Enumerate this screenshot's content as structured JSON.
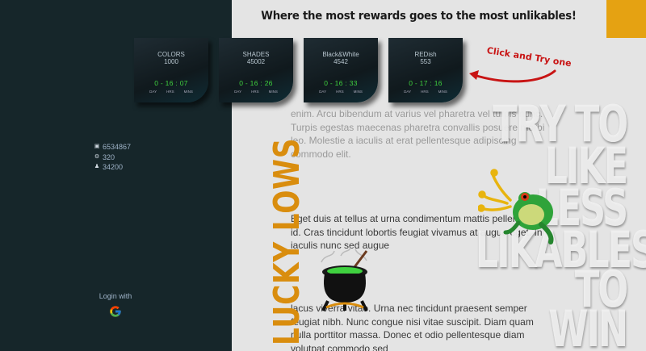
{
  "header": {
    "headline": "Where the most rewards goes to the most unlikables!"
  },
  "cards": [
    {
      "name": "COLORS",
      "count": "1000",
      "timer": "0 - 16 : 07"
    },
    {
      "name": "SHADES",
      "count": "45002",
      "timer": "0 - 16 : 26"
    },
    {
      "name": "Black&White",
      "count": "4542",
      "timer": "0 - 16 : 33"
    },
    {
      "name": "REDish",
      "count": "553",
      "timer": "0 - 17 : 16"
    }
  ],
  "timer_units": {
    "day": "DAY",
    "hrs": "HRS",
    "mins": "MINS"
  },
  "annotation": {
    "text": "Click and Try one"
  },
  "stats": [
    {
      "icon": "trash-icon",
      "value": "6534867"
    },
    {
      "icon": "gear-icon",
      "value": "320"
    },
    {
      "icon": "users-icon",
      "value": "34200"
    }
  ],
  "login": {
    "label": "Login with",
    "provider_icon": "google-icon"
  },
  "side_title": "LUCKY LOWS",
  "overlay_text": [
    "TRY TO",
    "LIKE",
    "LESS",
    "LIKABLES",
    "TO",
    "WIN"
  ],
  "paragraphs": [
    "enim. Arcu bibendum at varius vel pharetra vel turpis nunc. Turpis egestas maecenas pharetra convallis posuere morbi leo. Molestie a iaculis at erat pellentesque adipiscing commodo elit.",
    "Eget duis at tellus at urna condimentum mattis pellentesque id. Cras tincidunt lobortis feugiat vivamus at augue eget. In iaculis nunc sed augue",
    "lacus viverra vitae. Urna nec tincidunt praesent semper feugiat nibh. Nunc congue nisi vitae suscipit. Diam quam nulla porttitor massa. Donec et odio pellentesque diam volutpat commodo sed"
  ],
  "colors": {
    "sidebar": "#16262a",
    "accent": "#e5a212",
    "timer": "#3fd13f",
    "annotation": "#c81414"
  }
}
